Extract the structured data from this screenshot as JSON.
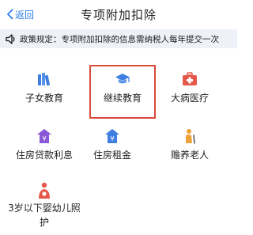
{
  "header": {
    "back_label": "返回",
    "title": "专项附加扣除"
  },
  "notice": {
    "text": "政策规定：专项附加扣除的信息需纳税人每年提交一次"
  },
  "items": [
    {
      "label": "子女教育",
      "icon": "books-icon",
      "color": "#3f7fe0"
    },
    {
      "label": "继续教育",
      "icon": "graduation-cap-icon",
      "color": "#3f7fe0",
      "highlighted": true
    },
    {
      "label": "大病医疗",
      "icon": "medical-kit-icon",
      "color": "#e6574a"
    },
    {
      "label": "住房贷款利息",
      "icon": "house-loan-icon",
      "color": "#8a57d6"
    },
    {
      "label": "住房租金",
      "icon": "house-rent-icon",
      "color": "#3f7fe0"
    },
    {
      "label": "赡养老人",
      "icon": "elderly-person-icon",
      "color": "#f0a23a"
    },
    {
      "label": "3岁以下婴幼儿照护",
      "icon": "infant-care-icon",
      "color": "#e6574a"
    }
  ],
  "colors": {
    "accent": "#2b7ee8",
    "highlight_border": "#d94b3a",
    "notice_bg": "#eef2f8"
  }
}
